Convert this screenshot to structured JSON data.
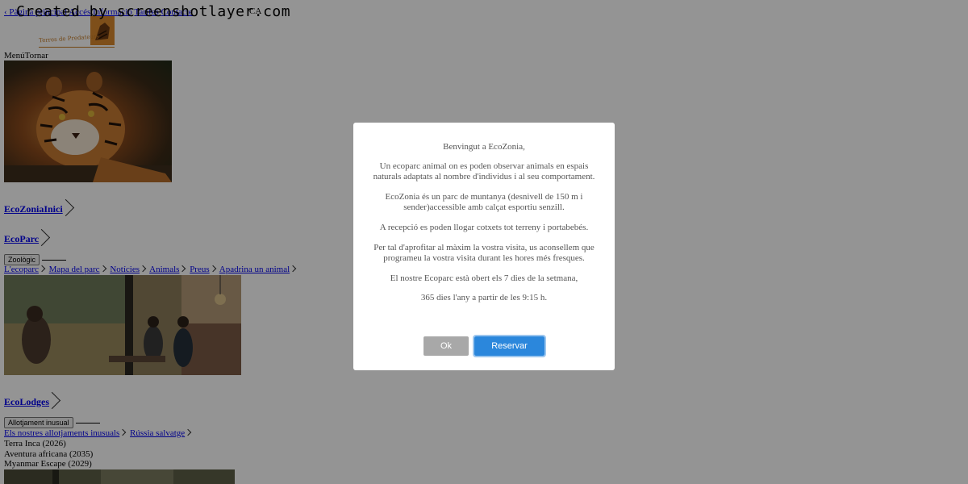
{
  "watermark": "Created by screenshotlayer.com",
  "topbar": {
    "back_label": "‹ Pàgina principal",
    "links": [
      "Accés",
      "Informació",
      "Tarifes",
      "Contacte"
    ],
    "lang": "CA"
  },
  "logo": {
    "text": "Terres de Predateurs"
  },
  "nav": {
    "menu": "Menú",
    "back": "Tornar"
  },
  "ecozonia": {
    "title": "EcoZoniaInici"
  },
  "ecoparc": {
    "title": "EcoParc",
    "button": "Zoològic",
    "links": [
      "L'ecoparc",
      "Mapa del parc",
      "Notícies",
      "Animals",
      "Preus",
      "Apadrina un animal"
    ]
  },
  "ecolodges": {
    "title": "EcoLodges",
    "button": "Allotjament inusual",
    "links": [
      "Els nostres allotjaments inusuals",
      "Rússia salvatge"
    ],
    "items": [
      "Terra Inca (2026)",
      "Aventura africana (2035)",
      "Myanmar Escape (2029)"
    ]
  },
  "modal": {
    "greeting": "Benvingut a EcoZonia,",
    "p1": "Un ecoparc animal on es poden observar animals en espais naturals adaptats al nombre d'individus i al seu comportament.",
    "p2": "EcoZonia és un parc de muntanya (desnivell de 150 m i sender)accessible amb calçat esportiu senzill.",
    "p3": "A recepció es poden llogar cotxets tot terreny i portabebés.",
    "p4": "Per tal d'aprofitar al màxim la vostra visita, us aconsellem que programeu la vostra visita durant les hores més fresques.",
    "p5": "El nostre Ecoparc està obert els 7 dies de la setmana,",
    "p6": "365 dies l'any a partir de les 9:15 h.",
    "ok": "Ok",
    "reserve": "Reservar"
  }
}
